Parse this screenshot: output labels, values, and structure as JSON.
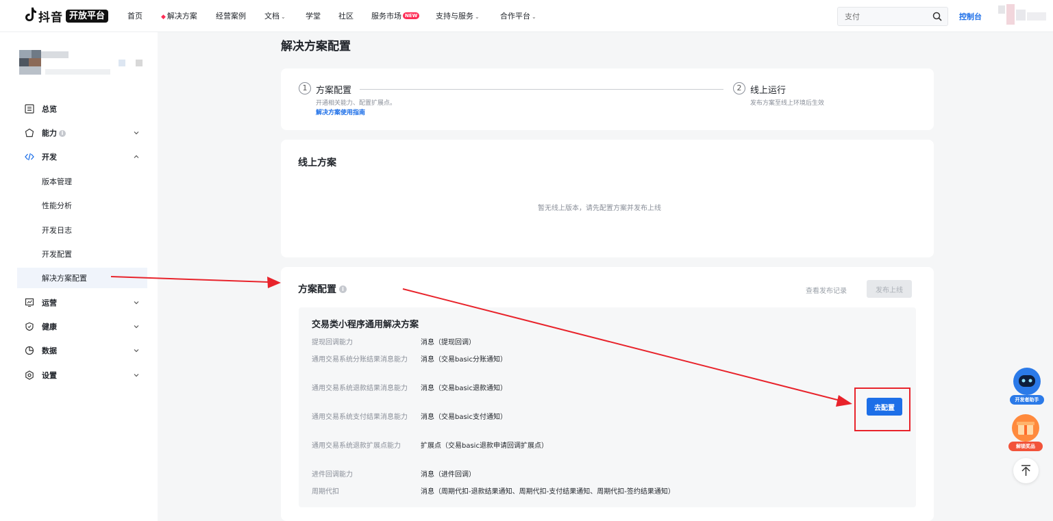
{
  "nav": {
    "logo_text": "抖音",
    "logo_badge": "开放平台",
    "items": [
      {
        "label": "首页"
      },
      {
        "label": "解决方案"
      },
      {
        "label": "经营案例"
      },
      {
        "label": "文档"
      },
      {
        "label": "学堂"
      },
      {
        "label": "社区"
      },
      {
        "label": "服务市场",
        "badge": "NEW"
      },
      {
        "label": "支持与服务"
      },
      {
        "label": "合作平台"
      }
    ],
    "search_placeholder": "支付",
    "console_label": "控制台"
  },
  "sidebar": {
    "menu": [
      {
        "label": "总览",
        "icon": "dashboard-icon"
      },
      {
        "label": "能力",
        "icon": "capability-icon"
      },
      {
        "label": "开发",
        "icon": "code-icon"
      },
      {
        "label": "运营",
        "icon": "operations-icon"
      },
      {
        "label": "健康",
        "icon": "health-icon"
      },
      {
        "label": "数据",
        "icon": "pie-chart-icon"
      },
      {
        "label": "设置",
        "icon": "settings-icon"
      }
    ],
    "dev_sub": [
      {
        "label": "版本管理"
      },
      {
        "label": "性能分析"
      },
      {
        "label": "开发日志"
      },
      {
        "label": "开发配置"
      },
      {
        "label": "解决方案配置"
      }
    ],
    "active_item": "解决方案配置"
  },
  "main": {
    "page_title": "解决方案配置",
    "steps": [
      {
        "num": "1",
        "title": "方案配置",
        "desc": "开通相关能力、配置扩展点。",
        "link": "解决方案使用指南"
      },
      {
        "num": "2",
        "title": "线上运行",
        "desc": "发布方案至线上环境后生效"
      }
    ],
    "online": {
      "title": "线上方案",
      "empty": "暂无线上版本，请先配置方案并发布上线"
    },
    "config": {
      "title": "方案配置",
      "history_link": "查看发布记录",
      "publish_button": "发布上线",
      "solution_title": "交易类小程序通用解决方案",
      "rows": [
        {
          "label": "提现回调能力",
          "value": "消息（提现回调）"
        },
        {
          "label": "通用交易系统分账结果消息能力",
          "value": "消息（交易basic分账通知）"
        },
        {
          "label": "通用交易系统退款结果消息能力",
          "value": "消息（交易basic退款通知）"
        },
        {
          "label": "通用交易系统支付结果消息能力",
          "value": "消息（交易basic支付通知）"
        },
        {
          "label": "通用交易系统退款扩展点能力",
          "value": "扩展点（交易basic退款申请回调扩展点）"
        },
        {
          "label": "进件回调能力",
          "value": "消息（进件回调）"
        },
        {
          "label": "周期代扣",
          "value": "消息（周期代扣-退款结果通知、周期代扣-支付结果通知、周期代扣-签约结果通知）"
        }
      ],
      "configure_button": "去配置"
    }
  },
  "floating": {
    "assistant_label": "开发者助手",
    "reward_label": "解锁奖品"
  },
  "colors": {
    "primary": "#1d6fe8",
    "brand_red": "#fe2c55",
    "annotation_red": "#e8232b"
  }
}
